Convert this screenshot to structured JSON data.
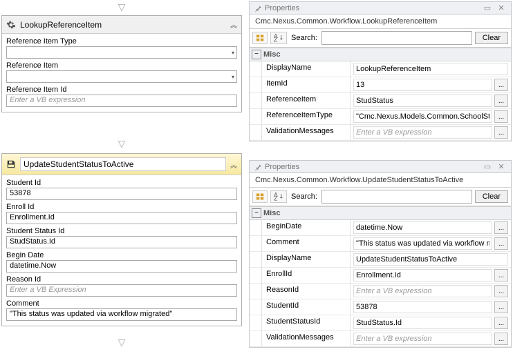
{
  "labels": {
    "properties_title": "Properties",
    "search_label": "Search:",
    "clear": "Clear",
    "misc": "Misc",
    "ellipsis": "...",
    "placeholder_vb": "Enter a VB expression",
    "placeholder_vb2": "Enter a VB Expression"
  },
  "lookup_panel": {
    "title": "LookupReferenceItem",
    "fields": {
      "ref_type_label": "Reference Item Type",
      "ref_item_label": "Reference Item",
      "ref_id_label": "Reference Item Id"
    }
  },
  "update_panel": {
    "title": "UpdateStudentStatusToActive",
    "fields": {
      "student_id_label": "Student Id",
      "student_id_value": "53878",
      "enroll_id_label": "Enroll Id",
      "enroll_id_value": "Enrollment.Id",
      "student_status_id_label": "Student Status Id",
      "student_status_id_value": "StudStatus.Id",
      "begin_date_label": "Begin Date",
      "begin_date_value": "datetime.Now",
      "reason_id_label": "Reason Id",
      "reason_id_value": "",
      "comment_label": "Comment",
      "comment_value": "\"This status was updated via workflow migrated\""
    }
  },
  "prop1": {
    "qualified": "Cmc.Nexus.Common.Workflow.LookupReferenceItem",
    "rows": [
      {
        "name": "DisplayName",
        "value": "LookupReferenceItem",
        "ellipsis": false,
        "placeholder": false
      },
      {
        "name": "ItemId",
        "value": "13",
        "ellipsis": true,
        "placeholder": false
      },
      {
        "name": "ReferenceItem",
        "value": "StudStatus",
        "ellipsis": true,
        "placeholder": false
      },
      {
        "name": "ReferenceItemType",
        "value": "\"Cmc.Nexus.Models.Common.SchoolStatus\"",
        "ellipsis": true,
        "placeholder": false
      },
      {
        "name": "ValidationMessages",
        "value": "Enter a VB expression",
        "ellipsis": true,
        "placeholder": true
      }
    ]
  },
  "prop2": {
    "qualified": "Cmc.Nexus.Common.Workflow.UpdateStudentStatusToActive",
    "rows": [
      {
        "name": "BeginDate",
        "value": "datetime.Now",
        "ellipsis": true,
        "placeholder": false
      },
      {
        "name": "Comment",
        "value": "\"This status was updated via workflow migrated\"",
        "ellipsis": true,
        "placeholder": false
      },
      {
        "name": "DisplayName",
        "value": "UpdateStudentStatusToActive",
        "ellipsis": false,
        "placeholder": false
      },
      {
        "name": "EnrollId",
        "value": "Enrollment.Id",
        "ellipsis": true,
        "placeholder": false
      },
      {
        "name": "ReasonId",
        "value": "Enter a VB expression",
        "ellipsis": true,
        "placeholder": true
      },
      {
        "name": "StudentId",
        "value": "53878",
        "ellipsis": true,
        "placeholder": false
      },
      {
        "name": "StudentStatusId",
        "value": "StudStatus.Id",
        "ellipsis": true,
        "placeholder": false
      },
      {
        "name": "ValidationMessages",
        "value": "Enter a VB expression",
        "ellipsis": true,
        "placeholder": true
      }
    ]
  }
}
